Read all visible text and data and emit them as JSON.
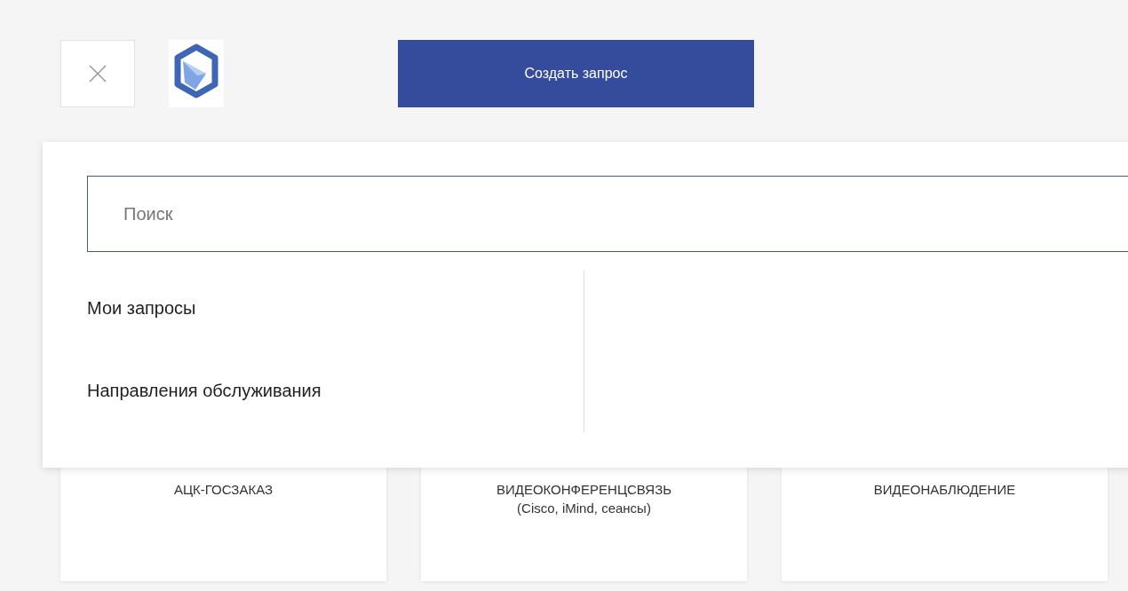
{
  "header": {
    "create_button": "Создать запрос"
  },
  "search": {
    "placeholder": "Поиск"
  },
  "menu": [
    {
      "label": "Мои запросы"
    },
    {
      "label": "Направления обслуживания"
    }
  ],
  "cards": [
    {
      "title": "АЦК-ГОСЗАКАЗ"
    },
    {
      "title": "ВИДЕОКОНФЕРЕНЦСВЯЗЬ",
      "subtitle": "(Cisco, iMind, сеансы)"
    },
    {
      "title": "ВИДЕОНАБЛЮДЕНИЕ"
    }
  ]
}
